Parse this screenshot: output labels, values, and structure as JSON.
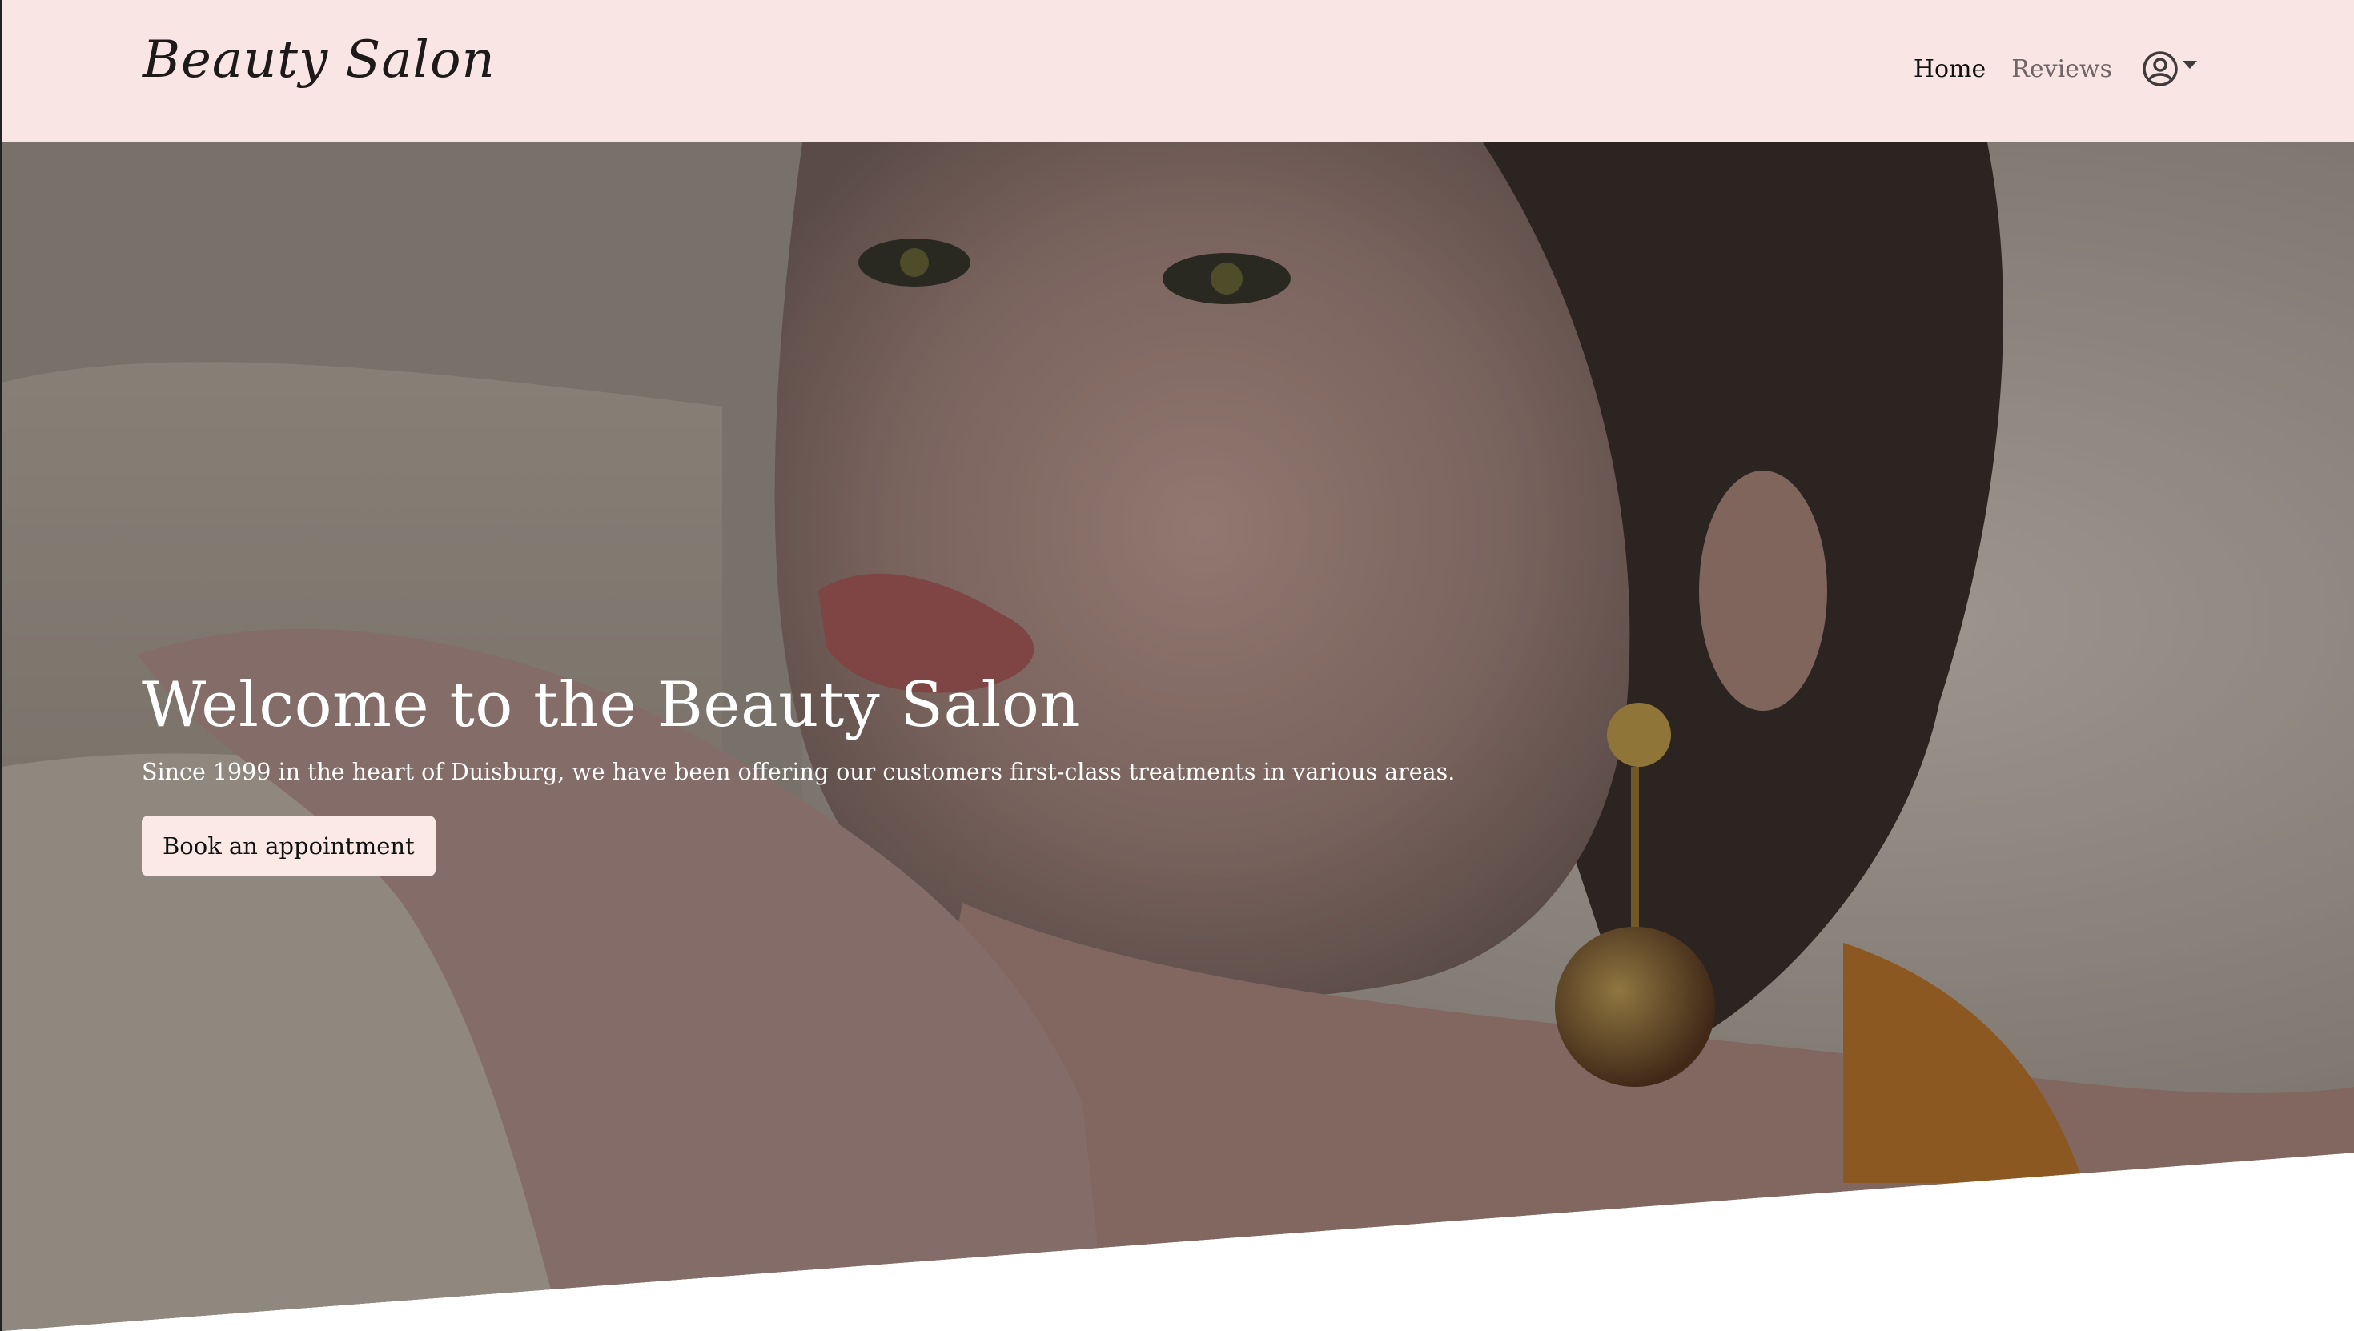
{
  "colors": {
    "navbar_bg": "#f9e6e4",
    "button_bg": "#fbe9e6",
    "hero_text": "#ffffff",
    "nav_active": "#111111",
    "nav_muted": "#6f6466"
  },
  "navbar": {
    "brand": "Beauty Salon",
    "links": [
      {
        "label": "Home",
        "active": true
      },
      {
        "label": "Reviews",
        "active": false
      }
    ],
    "account_icon": "user-circle-icon",
    "dropdown_icon": "caret-down-icon"
  },
  "hero": {
    "title": "Welcome to the Beauty Salon",
    "subtitle": "Since 1999 in the heart of Duisburg, we have been offering our customers first-class treatments in various areas.",
    "cta_label": "Book an appointment",
    "background": "portrait photo with dark overlay"
  }
}
